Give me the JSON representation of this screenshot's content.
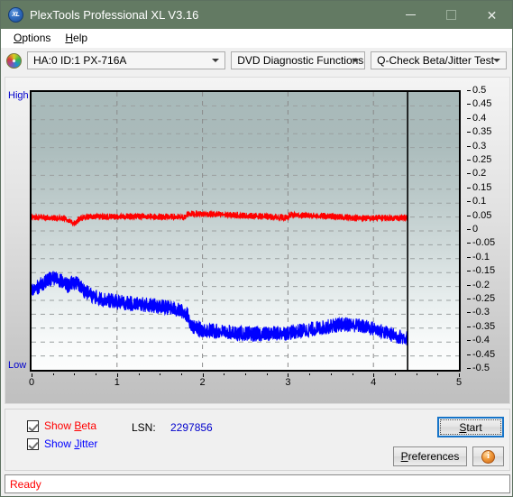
{
  "window": {
    "title": "PlexTools Professional XL V3.16",
    "icon": "XL",
    "app_icon_name": "plextools-logo-icon",
    "minimize_label": "–",
    "maximize_label": "□",
    "close_label": "✕",
    "titlebar_color": "#637a63"
  },
  "menu": {
    "items": [
      {
        "label": "Options",
        "mnemonic": "O"
      },
      {
        "label": "Help",
        "mnemonic": "H"
      }
    ]
  },
  "toolbar": {
    "disc_icon": "disc-icon",
    "drive_select": {
      "value": "HA:0 ID:1  PX-716A",
      "options": [
        "HA:0 ID:1  PX-716A"
      ]
    },
    "function_select": {
      "value": "DVD Diagnostic Functions",
      "options": [
        "DVD Diagnostic Functions"
      ]
    },
    "test_select": {
      "value": "Q-Check Beta/Jitter Test",
      "options": [
        "Q-Check Beta/Jitter Test"
      ]
    }
  },
  "chart_data": {
    "type": "line",
    "title": "",
    "xlabel": "",
    "ylabel": "",
    "xlim": [
      0,
      5
    ],
    "ylim": [
      -0.5,
      0.5
    ],
    "grid": true,
    "axis_left_label": "High",
    "axis_bottom_label": "Low",
    "axis_label_color": "#0000cc",
    "xticks": [
      0,
      1,
      2,
      3,
      4,
      5
    ],
    "xtick_labels": [
      "0",
      "1",
      "2",
      "3",
      "4",
      "5"
    ],
    "yticks": [
      0.5,
      0.45,
      0.4,
      0.35,
      0.3,
      0.25,
      0.2,
      0.15,
      0.1,
      0.05,
      0,
      -0.05,
      -0.1,
      -0.15,
      -0.2,
      -0.25,
      -0.3,
      -0.35,
      -0.4,
      -0.45,
      -0.5
    ],
    "ytick_labels": [
      "0.5",
      "0.45",
      "0.4",
      "0.35",
      "0.3",
      "0.25",
      "0.2",
      "0.15",
      "0.1",
      "0.05",
      "0",
      "-0.05",
      "-0.1",
      "-0.15",
      "-0.2",
      "-0.25",
      "-0.3",
      "-0.35",
      "-0.4",
      "-0.45",
      "-0.5"
    ],
    "data_end_x": 4.4,
    "background_gradient": [
      "#a8b9b9",
      "#fcfdfd"
    ],
    "series": [
      {
        "name": "Beta",
        "color": "#ff0000",
        "noise": 0.012,
        "x": [
          0.0,
          0.1,
          0.2,
          0.3,
          0.38,
          0.44,
          0.48,
          0.52,
          0.56,
          0.62,
          0.7,
          0.8,
          0.95,
          1.1,
          1.3,
          1.5,
          1.7,
          1.8,
          1.82,
          1.84,
          1.9,
          2.0,
          2.2,
          2.4,
          2.6,
          2.8,
          2.95,
          3.0,
          3.02,
          3.04,
          3.1,
          3.3,
          3.5,
          3.7,
          3.8,
          3.9,
          4.0,
          4.1,
          4.2,
          4.3,
          4.4
        ],
        "y": [
          0.05,
          0.049,
          0.048,
          0.047,
          0.046,
          0.04,
          0.028,
          0.03,
          0.044,
          0.05,
          0.051,
          0.052,
          0.052,
          0.052,
          0.052,
          0.051,
          0.05,
          0.049,
          0.06,
          0.062,
          0.062,
          0.061,
          0.059,
          0.057,
          0.054,
          0.051,
          0.048,
          0.047,
          0.057,
          0.058,
          0.057,
          0.055,
          0.052,
          0.049,
          0.047,
          0.046,
          0.046,
          0.047,
          0.047,
          0.047,
          0.047
        ]
      },
      {
        "name": "Jitter",
        "color": "#0000ff",
        "noise": 0.03,
        "x": [
          0.0,
          0.06,
          0.12,
          0.18,
          0.24,
          0.3,
          0.36,
          0.42,
          0.46,
          0.5,
          0.56,
          0.62,
          0.7,
          0.8,
          0.9,
          1.0,
          1.2,
          1.4,
          1.6,
          1.75,
          1.82,
          1.86,
          1.9,
          2.0,
          2.2,
          2.4,
          2.6,
          2.8,
          3.0,
          3.2,
          3.4,
          3.55,
          3.7,
          3.85,
          4.0,
          4.1,
          4.2,
          4.3,
          4.4
        ],
        "y": [
          -0.215,
          -0.205,
          -0.19,
          -0.178,
          -0.172,
          -0.17,
          -0.182,
          -0.198,
          -0.192,
          -0.183,
          -0.196,
          -0.215,
          -0.232,
          -0.243,
          -0.25,
          -0.255,
          -0.262,
          -0.268,
          -0.276,
          -0.288,
          -0.3,
          -0.33,
          -0.348,
          -0.356,
          -0.362,
          -0.368,
          -0.372,
          -0.37,
          -0.366,
          -0.358,
          -0.348,
          -0.34,
          -0.336,
          -0.342,
          -0.352,
          -0.362,
          -0.372,
          -0.38,
          -0.386
        ]
      }
    ]
  },
  "controls": {
    "show_beta": {
      "label": "Show Beta",
      "mnemonic": "B",
      "checked": true,
      "color": "#ff0000"
    },
    "show_jitter": {
      "label": "Show Jitter",
      "mnemonic": "J",
      "checked": true,
      "color": "#0000ff"
    },
    "lsn_label": "LSN:",
    "lsn_value": "2297856",
    "start_button": "Start",
    "preferences_button": "Preferences",
    "info_button": "i"
  },
  "statusbar": {
    "text": "Ready",
    "color": "#ff0000"
  }
}
